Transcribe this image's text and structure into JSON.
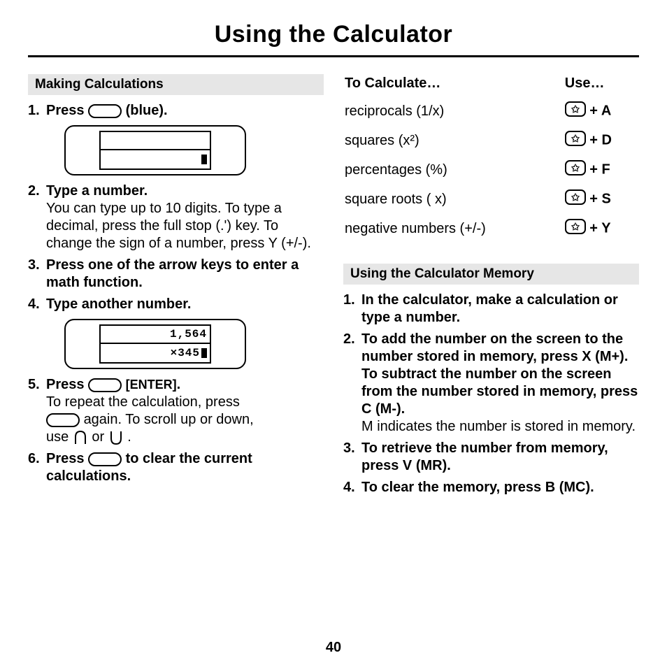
{
  "title": "Using the Calculator",
  "pageNumber": "40",
  "left": {
    "sectionHeader": "Making Calculations",
    "step1_a": "Press ",
    "step1_b": " (blue).",
    "lcd1_row1": "",
    "lcd1_row2": "",
    "step2_head": "Type a number.",
    "step2_body": "You can type up to 10 digits. To type a decimal, press the full stop (.') key. To change the sign of a number, press Y (+/-).",
    "step3_head": "Press one of the arrow keys to enter a math function.",
    "step4_head": "Type another number.",
    "lcd2_row1": "1,564",
    "lcd2_row2": "×345",
    "step5_a": "Press ",
    "step5_enter": "[ENTER]",
    "step5_b": ".",
    "step5_body1": "To repeat the calculation, press",
    "step5_body2_a": " again. To scroll up or down,",
    "step5_body3_a": "use ",
    "step5_body3_b": " or ",
    "step5_body3_c": ".",
    "step6_a": "Press ",
    "step6_b": " to clear the current calculations."
  },
  "right": {
    "tableHeadCalc": "To Calculate…",
    "tableHeadUse": "Use…",
    "rows": [
      {
        "calc": "reciprocals (1/x)",
        "key": "A"
      },
      {
        "calc": "squares (x²)",
        "key": "D"
      },
      {
        "calc": "percentages (%)",
        "key": "F"
      },
      {
        "calc": "square roots (  x)",
        "key": "S"
      },
      {
        "calc": "negative numbers (+/-)",
        "key": "Y"
      }
    ],
    "memHeader": "Using the Calculator Memory",
    "mem1": "In the calculator, make a calculation or type a number.",
    "mem2_strong": "To add the number on the screen to the number stored in memory, press X (M+). To subtract the number on the screen from the number stored in memory, press C (M-).",
    "mem2_body": "M indicates the number is stored in memory.",
    "mem3": "To retrieve the number from memory, press V (MR).",
    "mem4": "To clear the memory, press B (MC)."
  }
}
